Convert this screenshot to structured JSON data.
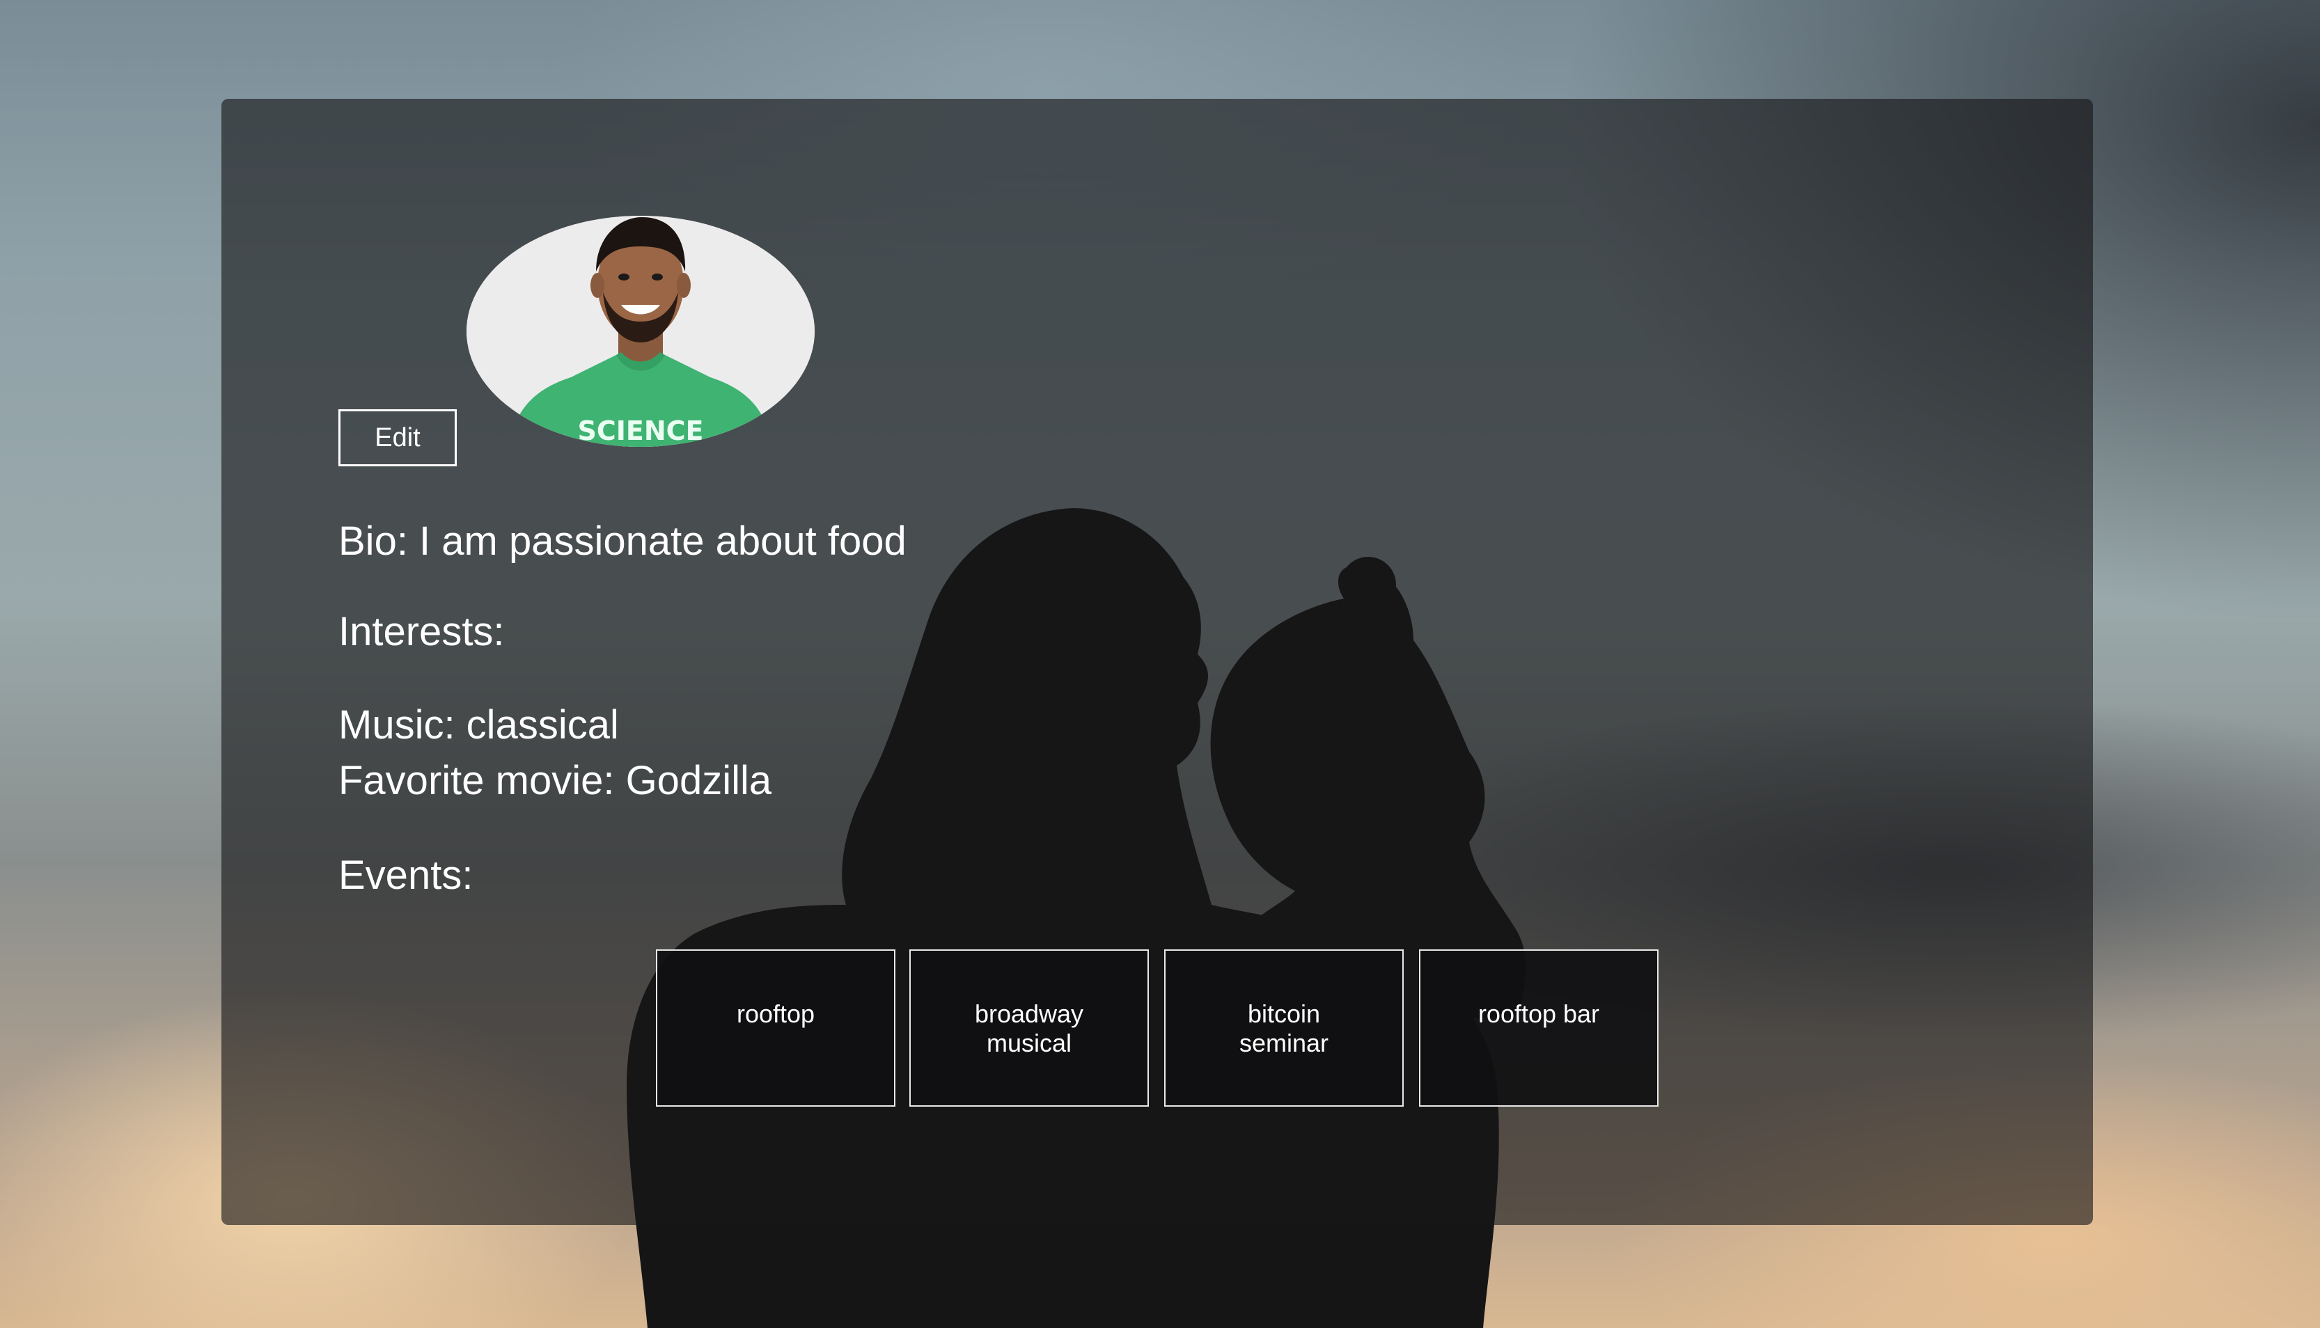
{
  "profile": {
    "edit_label": "Edit",
    "bio": "Bio: I am passionate about food",
    "interests_heading": "Interests:",
    "music": "Music: classical",
    "favorite_movie": "Favorite movie: Godzilla",
    "events_heading": "Events:",
    "shirt_text": "SCIENCE"
  },
  "events": [
    {
      "label": "rooftop"
    },
    {
      "label": "broadway musical"
    },
    {
      "label": "bitcoin seminar"
    },
    {
      "label": "rooftop bar"
    }
  ],
  "colors": {
    "text": "#ffffff",
    "shirt": "#3fb371",
    "panel": "#161618"
  },
  "icons": {
    "avatar": "profile-photo"
  }
}
